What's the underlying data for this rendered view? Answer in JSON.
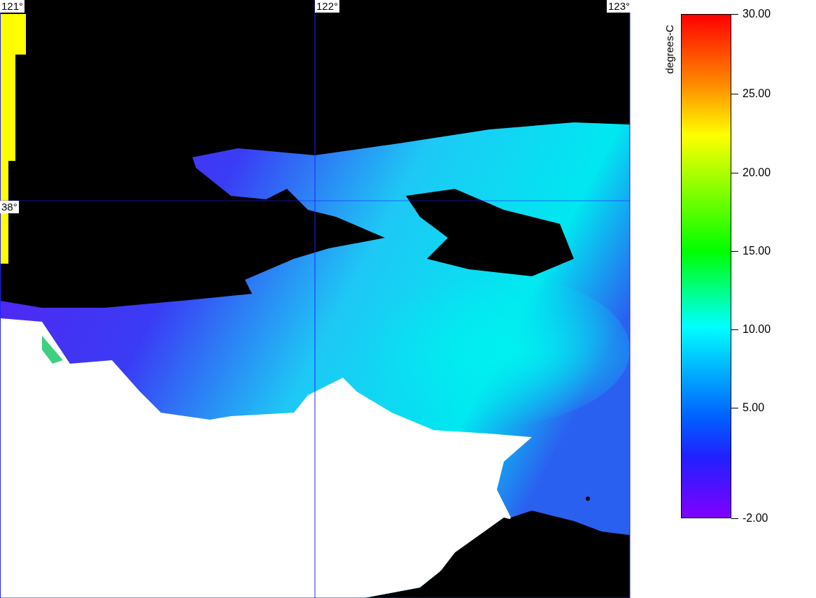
{
  "map": {
    "lon_labels": [
      "121°",
      "122°",
      "123°"
    ],
    "lat_labels": [
      "38°"
    ]
  },
  "legend": {
    "unit": "degrees-C",
    "ticks": [
      "30.00",
      "25.00",
      "20.00",
      "15.00",
      "10.00",
      "5.00",
      "-2.00"
    ]
  }
}
